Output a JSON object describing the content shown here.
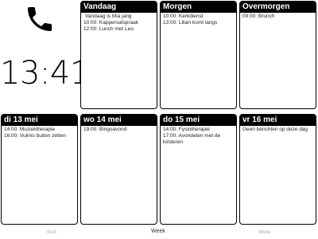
{
  "clock": {
    "time": "13:41"
  },
  "days": [
    {
      "title": "Vandaag",
      "events": [
        "Vandaag is Mia jarig",
        "10:00: Kappersafspraak",
        "12:00: Lunch met Leo"
      ]
    },
    {
      "title": "Morgen",
      "events": [
        "10:00: Kerkdienst",
        "13:00: Lilian komt langs"
      ]
    },
    {
      "title": "Overmorgen",
      "events": [
        "09:00: Brunch"
      ]
    },
    {
      "title": "di 13 mei",
      "events": [
        "14:00: Muziektherapie",
        "16:00: Vuilnis buiten zetten"
      ]
    },
    {
      "title": "wo 14 mei",
      "events": [
        "19:00: Bingoavond"
      ]
    },
    {
      "title": "do 15 mei",
      "events": [
        "14:00: Fysiotherapie",
        "17:00: Avondeten met de kinderen"
      ]
    },
    {
      "title": "vr 16 mei",
      "events": [
        "Geen berichten op deze dag"
      ]
    }
  ],
  "footer": {
    "klok": "Klok",
    "week": "Week",
    "menu": "Menu"
  }
}
